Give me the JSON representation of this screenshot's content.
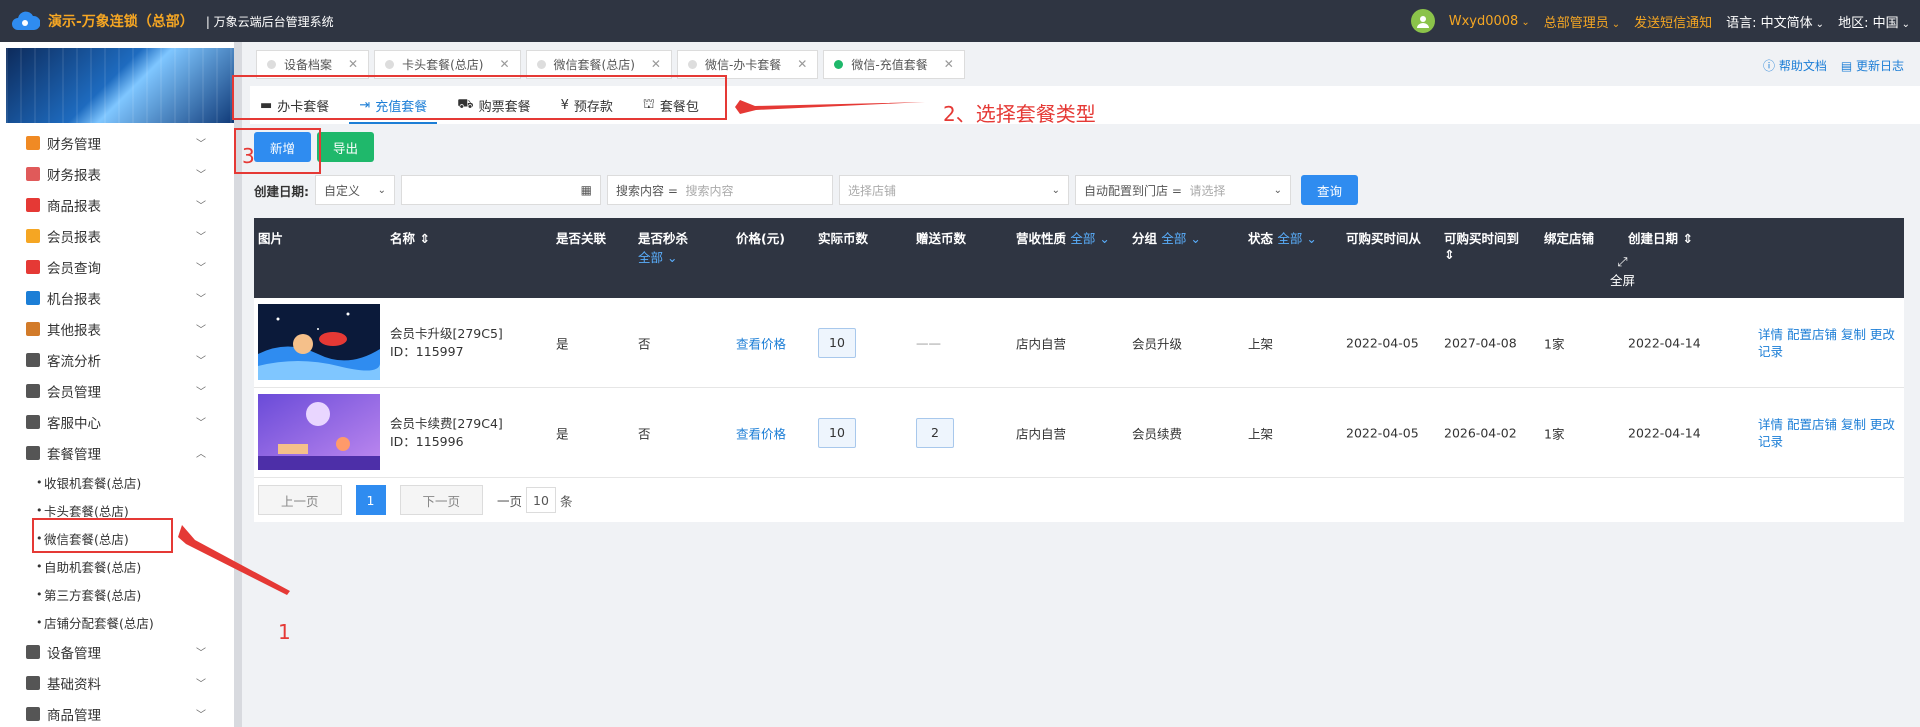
{
  "header": {
    "app_title": "演示-万象连锁（总部）",
    "app_subtitle": "| 万象云端后台管理系统",
    "user": "Wxyd0008",
    "role": "总部管理员",
    "sms": "发送短信通知",
    "lang_label": "语言:",
    "lang_value": "中文简体",
    "region_label": "地区:",
    "region_value": "中国"
  },
  "sidebar": {
    "items": [
      {
        "label": "财务管理",
        "color": "#f08a24"
      },
      {
        "label": "财务报表",
        "color": "#e05a5a"
      },
      {
        "label": "商品报表",
        "color": "#e53935"
      },
      {
        "label": "会员报表",
        "color": "#f5a623"
      },
      {
        "label": "会员查询",
        "color": "#e53935"
      },
      {
        "label": "机台报表",
        "color": "#1c7ed6"
      },
      {
        "label": "其他报表",
        "color": "#d27b2a"
      },
      {
        "label": "客流分析",
        "color": "#555555"
      },
      {
        "label": "会员管理",
        "color": "#555555"
      },
      {
        "label": "客服中心",
        "color": "#555555"
      },
      {
        "label": "套餐管理",
        "color": "#555555"
      }
    ],
    "sub_items": [
      "收银机套餐(总店)",
      "卡头套餐(总店)",
      "微信套餐(总店)",
      "自助机套餐(总店)",
      "第三方套餐(总店)",
      "店铺分配套餐(总店)"
    ],
    "bottom_items": [
      {
        "label": "设备管理",
        "color": "#555555"
      },
      {
        "label": "基础资料",
        "color": "#555555"
      },
      {
        "label": "商品管理",
        "color": "#555555"
      }
    ]
  },
  "tabs": [
    {
      "label": "设备档案",
      "active": false
    },
    {
      "label": "卡头套餐(总店)",
      "active": false
    },
    {
      "label": "微信套餐(总店)",
      "active": false
    },
    {
      "label": "微信-办卡套餐",
      "active": false
    },
    {
      "label": "微信-充值套餐",
      "active": true
    }
  ],
  "help": {
    "docs": "帮助文档",
    "changelog": "更新日志"
  },
  "subtabs": [
    {
      "icon": "▬",
      "label": "办卡套餐"
    },
    {
      "icon": "⇥",
      "label": "充值套餐"
    },
    {
      "icon": "⛟",
      "label": "购票套餐"
    },
    {
      "icon": "¥",
      "label": "预存款"
    },
    {
      "icon": "⛫",
      "label": "套餐包"
    }
  ],
  "toolbar": {
    "add": "新增",
    "export": "导出"
  },
  "filters": {
    "date_label": "创建日期:",
    "date_mode": "自定义",
    "search_label": "搜索内容 =",
    "search_placeholder": "搜索内容",
    "store_placeholder": "选择店铺",
    "auto_label": "自动配置到门店 =",
    "auto_placeholder": "请选择",
    "query": "查询"
  },
  "table": {
    "headers": {
      "image": "图片",
      "name": "名称",
      "linked": "是否关联",
      "flash": "是否秒杀",
      "all": "全部",
      "price": "价格(元)",
      "coins": "实际币数",
      "gift": "赠送币数",
      "revenue": "营收性质",
      "group": "分组",
      "status": "状态",
      "from": "可购买时间从",
      "to": "可购买时间到",
      "store": "绑定店铺",
      "created": "创建日期",
      "fullscreen": "全屏"
    },
    "rows": [
      {
        "name": "会员卡升级[279C5]",
        "id": "ID：115997",
        "linked": "是",
        "flash": "否",
        "price": "查看价格",
        "coins": "10",
        "gift": "——",
        "revenue": "店内自营",
        "group": "会员升级",
        "status": "上架",
        "from": "2022-04-05",
        "to": "2027-04-08",
        "store": "1家",
        "created": "2022-04-14",
        "actions": "详情 配置店铺 复制 更改记录"
      },
      {
        "name": "会员卡续费[279C4]",
        "id": "ID：115996",
        "linked": "是",
        "flash": "否",
        "price": "查看价格",
        "coins": "10",
        "gift": "2",
        "revenue": "店内自营",
        "group": "会员续费",
        "status": "上架",
        "from": "2022-04-05",
        "to": "2026-04-02",
        "store": "1家",
        "created": "2022-04-14",
        "actions": "详情 配置店铺 复制 更改记录"
      }
    ]
  },
  "pager": {
    "prev": "上一页",
    "current": "1",
    "next": "下一页",
    "per_label": "一页",
    "per_value": "10",
    "unit": "条"
  },
  "annotations": {
    "step1": "1",
    "step2": "2、选择套餐类型",
    "step3": "3"
  }
}
